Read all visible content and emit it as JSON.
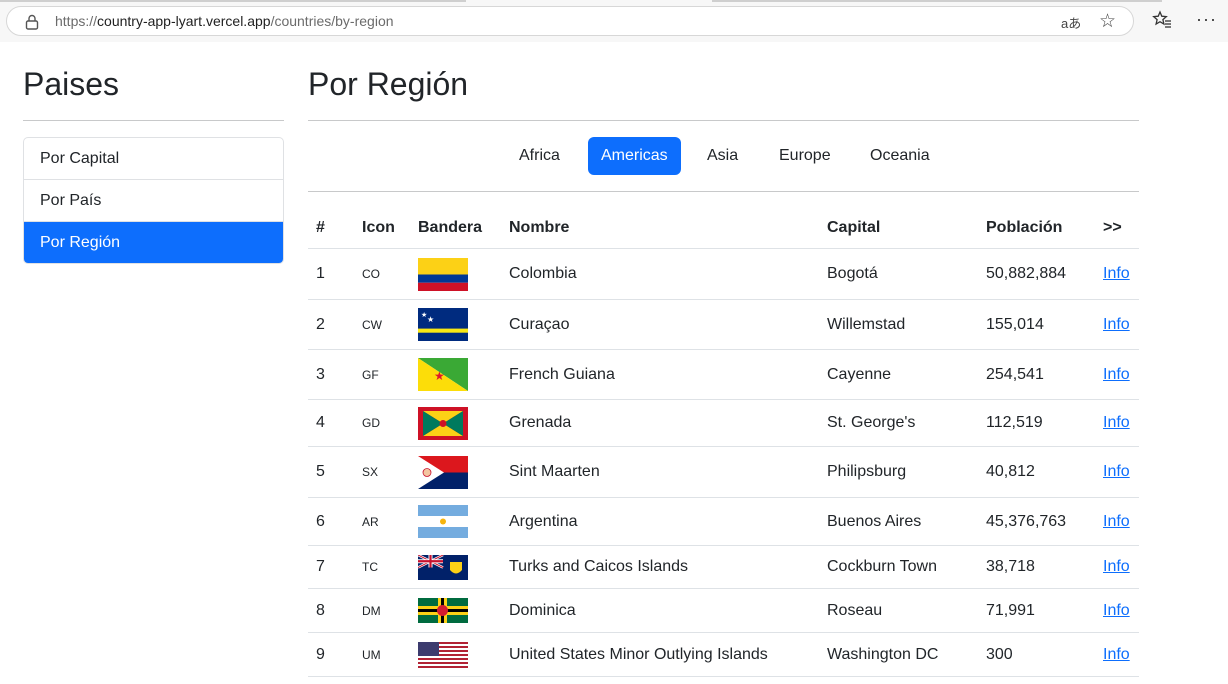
{
  "browser": {
    "url_scheme": "https://",
    "url_host": "country-app-lyart.vercel.app",
    "url_path": "/countries/by-region",
    "read_aloud_glyph": "aあ"
  },
  "sidebar": {
    "title": "Paises",
    "items": [
      {
        "label": "Por Capital",
        "active": false
      },
      {
        "label": "Por País",
        "active": false
      },
      {
        "label": "Por Región",
        "active": true
      }
    ]
  },
  "main": {
    "title": "Por Región",
    "regions": [
      {
        "label": "Africa",
        "active": false
      },
      {
        "label": "Americas",
        "active": true
      },
      {
        "label": "Asia",
        "active": false
      },
      {
        "label": "Europe",
        "active": false
      },
      {
        "label": "Oceania",
        "active": false
      }
    ],
    "table": {
      "headers": [
        "#",
        "Icon",
        "Bandera",
        "Nombre",
        "Capital",
        "Población",
        ">>"
      ],
      "rows": [
        {
          "n": "1",
          "code": "CO",
          "flag": "colombia-flag",
          "name": "Colombia",
          "capital": "Bogotá",
          "population": "50,882,884",
          "link": "Info"
        },
        {
          "n": "2",
          "code": "CW",
          "flag": "curacao-flag",
          "name": "Curaçao",
          "capital": "Willemstad",
          "population": "155,014",
          "link": "Info"
        },
        {
          "n": "3",
          "code": "GF",
          "flag": "french-guiana-flag",
          "name": "French Guiana",
          "capital": "Cayenne",
          "population": "254,541",
          "link": "Info"
        },
        {
          "n": "4",
          "code": "GD",
          "flag": "grenada-flag",
          "name": "Grenada",
          "capital": "St. George's",
          "population": "112,519",
          "link": "Info"
        },
        {
          "n": "5",
          "code": "SX",
          "flag": "sint-maarten-flag",
          "name": "Sint Maarten",
          "capital": "Philipsburg",
          "population": "40,812",
          "link": "Info"
        },
        {
          "n": "6",
          "code": "AR",
          "flag": "argentina-flag",
          "name": "Argentina",
          "capital": "Buenos Aires",
          "population": "45,376,763",
          "link": "Info"
        },
        {
          "n": "7",
          "code": "TC",
          "flag": "turks-caicos-flag",
          "name": "Turks and Caicos Islands",
          "capital": "Cockburn Town",
          "population": "38,718",
          "link": "Info"
        },
        {
          "n": "8",
          "code": "DM",
          "flag": "dominica-flag",
          "name": "Dominica",
          "capital": "Roseau",
          "population": "71,991",
          "link": "Info"
        },
        {
          "n": "9",
          "code": "UM",
          "flag": "usa-flag",
          "name": "United States Minor Outlying Islands",
          "capital": "Washington DC",
          "population": "300",
          "link": "Info"
        }
      ]
    }
  },
  "colors": {
    "accent": "#0d6efd"
  }
}
